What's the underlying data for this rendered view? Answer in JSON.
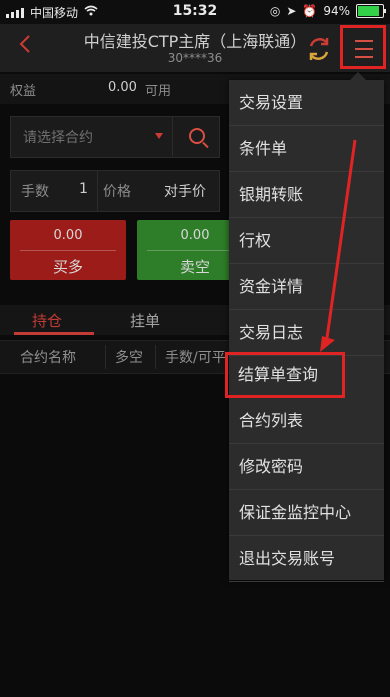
{
  "status": {
    "carrier": "中国移动",
    "time": "15:32",
    "battery": "94%",
    "battery_fraction": 0.94
  },
  "header": {
    "title": "中信建投CTP主席（上海联通）",
    "subtitle": "30****36",
    "back_icon": "chevron-left-icon",
    "refresh_icon": "refresh-icon",
    "menu_icon": "list-menu-icon"
  },
  "equity": {
    "label": "权益",
    "value": "0.00",
    "available": "可用"
  },
  "contract": {
    "placeholder": "请选择合约"
  },
  "order": {
    "qty_label": "手数",
    "qty_value": "1",
    "price_label": "价格",
    "price_value": "对手价"
  },
  "buttons": {
    "buy": {
      "amount": "0.00",
      "label": "买多"
    },
    "sell": {
      "amount": "0.00",
      "label": "卖空"
    }
  },
  "tabs": [
    "持仓",
    "挂单"
  ],
  "columns": [
    "合约名称",
    "多空",
    "手数/可平"
  ],
  "menu": {
    "items": [
      "交易设置",
      "条件单",
      "银期转账",
      "行权",
      "资金详情",
      "交易日志",
      "结算单查询",
      "合约列表",
      "修改密码",
      "保证金监控中心",
      "退出交易账号"
    ]
  },
  "colors": {
    "accent": "#d94f43",
    "buy": "#9c1c1a",
    "sell": "#2e7d28",
    "highlight": "#e02323"
  }
}
